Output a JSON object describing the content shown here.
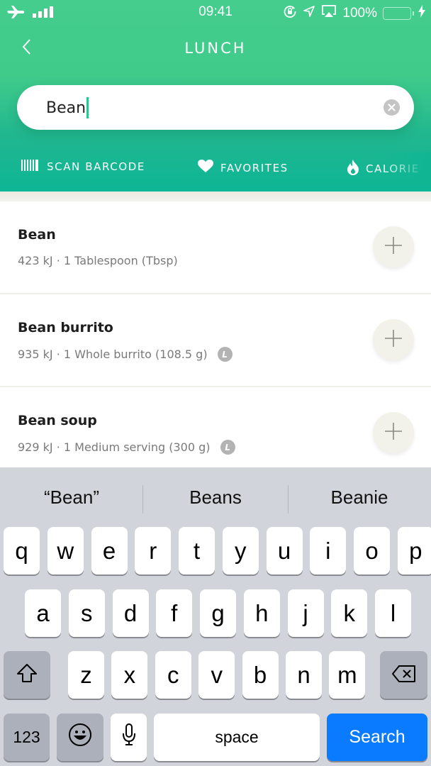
{
  "status_bar": {
    "time": "09:41",
    "battery_percent": "100%",
    "battery_level": 1.0,
    "icons": [
      "airplane-mode-icon",
      "signal-bars-icon",
      "orientation-lock-icon",
      "location-icon",
      "airplay-icon",
      "battery-icon",
      "charging-icon"
    ]
  },
  "nav": {
    "title": "LUNCH",
    "back_icon": "chevron-left-icon"
  },
  "search": {
    "value": "Bean",
    "clear_icon": "clear-icon"
  },
  "quick_tabs": [
    {
      "label": "SCAN BARCODE",
      "icon": "barcode-icon"
    },
    {
      "label": "FAVORITES",
      "icon": "heart-icon"
    },
    {
      "label": "CALORIE",
      "icon": "flame-icon"
    }
  ],
  "results": [
    {
      "name": "Bean",
      "energy": "423 kJ",
      "serving": "1 Tablespoon (Tbsp)",
      "premium_badge": false,
      "subtitle": "423 kJ · 1 Tablespoon (Tbsp)"
    },
    {
      "name": "Bean burrito",
      "energy": "935 kJ",
      "serving": "1 Whole burrito (108.5 g)",
      "premium_badge": true,
      "subtitle": "935 kJ · 1 Whole burrito (108.5 g)"
    },
    {
      "name": "Bean soup",
      "energy": "929 kJ",
      "serving": "1 Medium serving (300 g)",
      "premium_badge": true,
      "subtitle": "929 kJ · 1 Medium serving (300 g)"
    }
  ],
  "badge_glyph": "L",
  "keyboard": {
    "suggestions": [
      "“Bean”",
      "Beans",
      "Beanie"
    ],
    "row1": [
      "q",
      "w",
      "e",
      "r",
      "t",
      "y",
      "u",
      "i",
      "o",
      "p"
    ],
    "row2": [
      "a",
      "s",
      "d",
      "f",
      "g",
      "h",
      "j",
      "k",
      "l"
    ],
    "row3": [
      "z",
      "x",
      "c",
      "v",
      "b",
      "n",
      "m"
    ],
    "numbers_label": "123",
    "space_label": "space",
    "action_label": "Search",
    "colors": {
      "action": "#0a7aff",
      "background": "#d1d4da"
    }
  },
  "colors": {
    "header_top": "#44cd8c",
    "header_bottom": "#0db595",
    "caret": "#2cc48a"
  }
}
